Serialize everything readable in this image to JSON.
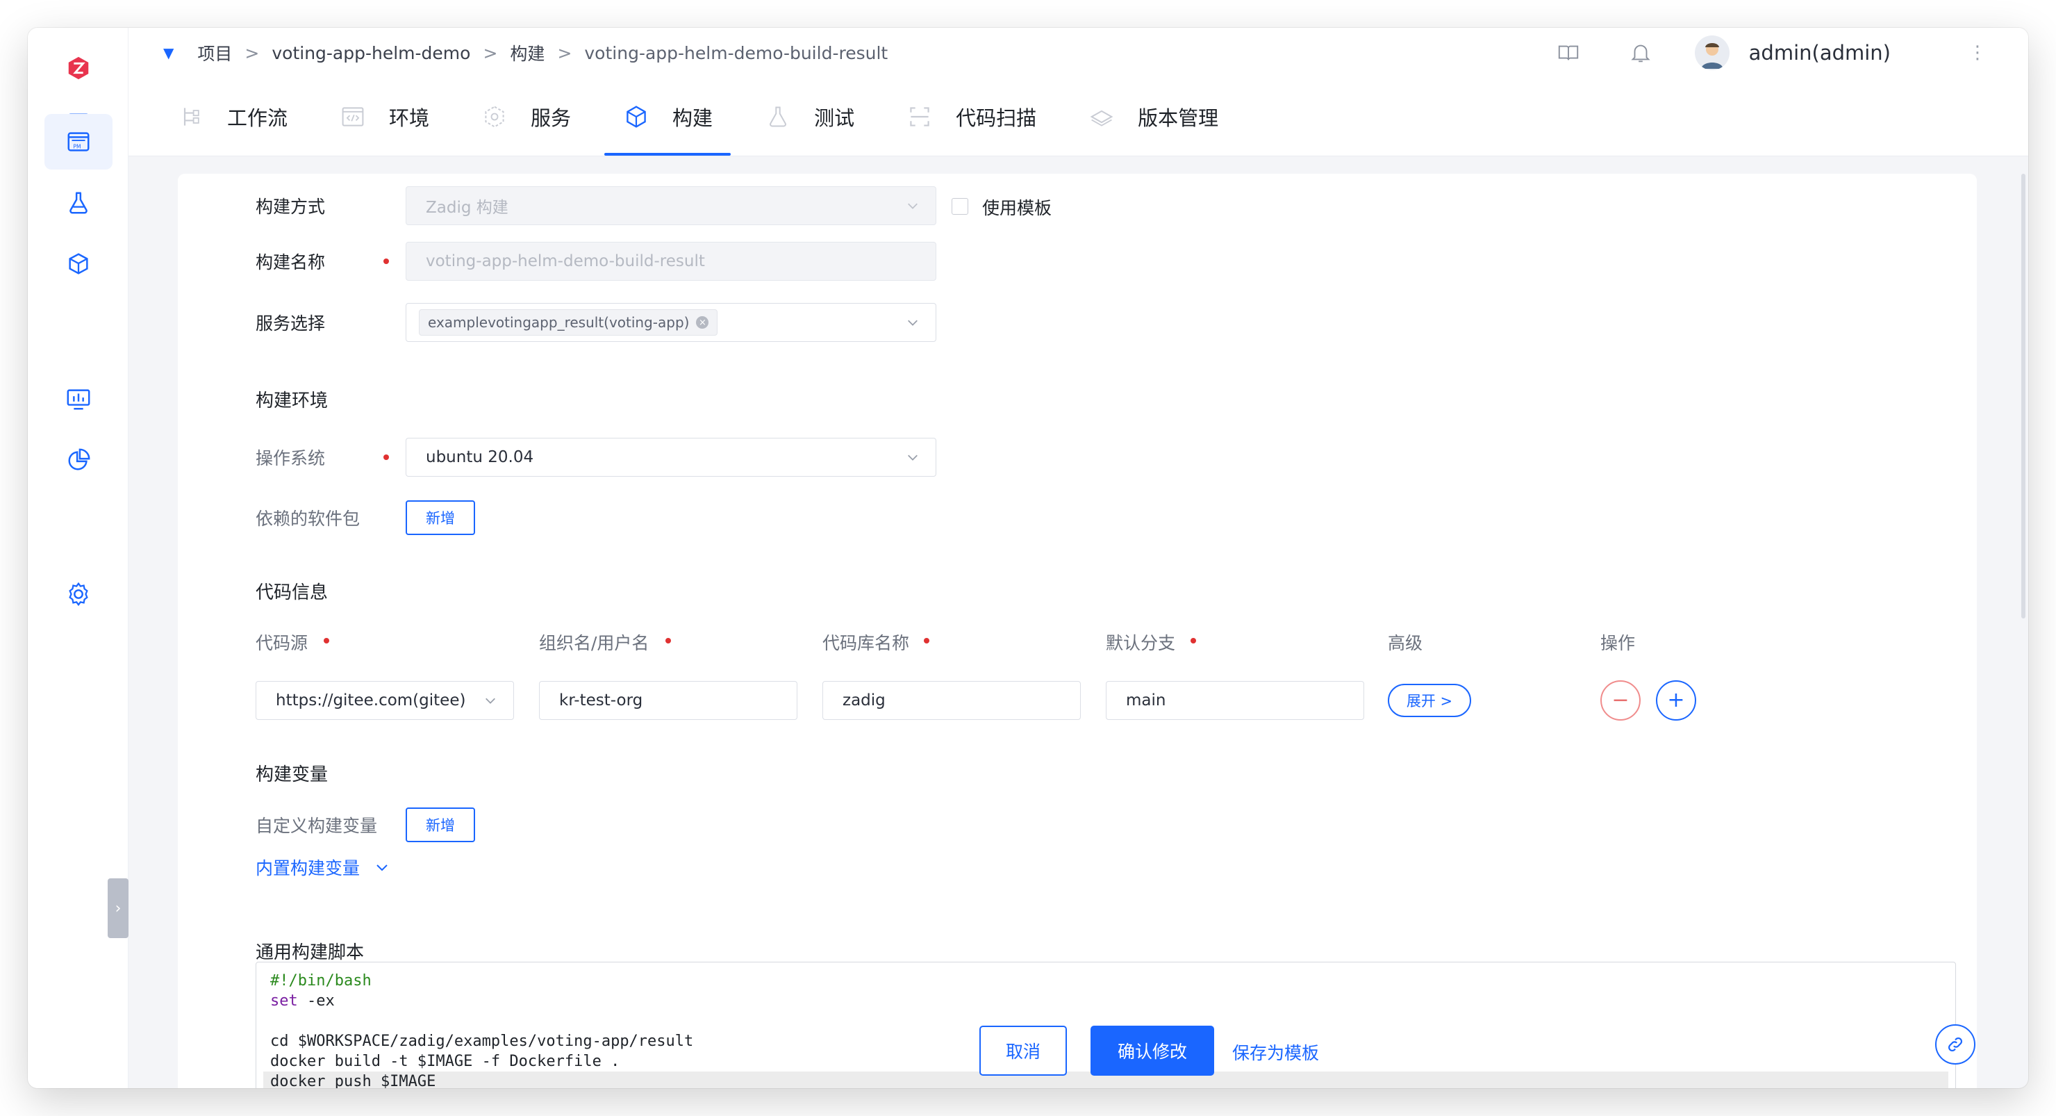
{
  "breadcrumb": {
    "items": [
      "项目",
      "voting-app-helm-demo",
      "构建",
      "voting-app-helm-demo-build-result"
    ],
    "separator": ">"
  },
  "header": {
    "user": "admin(admin)",
    "icons": [
      "docs-icon",
      "bell-icon",
      "more-icon"
    ]
  },
  "sidebar": {
    "icons": [
      "zadig-logo-icon",
      "pulse-icon",
      "project-icon",
      "flask-icon",
      "package-icon",
      "monitor-chart-icon",
      "pie-chart-icon",
      "gear-icon"
    ],
    "active": "project-icon"
  },
  "tabs": [
    {
      "label": "工作流",
      "icon": "workflow-icon"
    },
    {
      "label": "环境",
      "icon": "code-window-icon"
    },
    {
      "label": "服务",
      "icon": "services-icon"
    },
    {
      "label": "构建",
      "icon": "cube-icon",
      "active": true
    },
    {
      "label": "测试",
      "icon": "flask-icon"
    },
    {
      "label": "代码扫描",
      "icon": "scan-icon"
    },
    {
      "label": "版本管理",
      "icon": "version-icon"
    }
  ],
  "form": {
    "build_method_label": "构建方式",
    "build_method_value": "Zadig 构建",
    "use_template_label": "使用模板",
    "build_name_label": "构建名称",
    "build_name_value": "voting-app-helm-demo-build-result",
    "service_label": "服务选择",
    "service_tag": "examplevotingapp_result(voting-app)",
    "env_section": "构建环境",
    "os_label": "操作系统",
    "os_value": "ubuntu 20.04",
    "deps_label": "依赖的软件包",
    "add_label": "新增",
    "code_section": "代码信息",
    "col_source": "代码源",
    "col_org": "组织名/用户名",
    "col_repo": "代码库名称",
    "col_branch": "默认分支",
    "col_advanced": "高级",
    "col_action": "操作",
    "source_value": "https://gitee.com(gitee)",
    "org_value": "kr-test-org",
    "repo_value": "zadig",
    "branch_value": "main",
    "expand_label": "展开 >",
    "vars_section": "构建变量",
    "custom_vars_label": "自定义构建变量",
    "builtin_vars_label": "内置构建变量",
    "script_section": "通用构建脚本"
  },
  "script": {
    "line1": "#!/bin/bash",
    "line2_kw": "set",
    "line2_rest": " -ex",
    "line3": "",
    "line4": "cd $WORKSPACE/zadig/examples/voting-app/result",
    "line5": "docker build -t $IMAGE -f Dockerfile .",
    "line6": "docker push $IMAGE"
  },
  "actions": {
    "cancel": "取消",
    "confirm": "确认修改",
    "save_template": "保存为模板"
  },
  "colors": {
    "accent": "#1a66ff",
    "required": "#e03131",
    "danger_outline": "#f08c8c"
  }
}
